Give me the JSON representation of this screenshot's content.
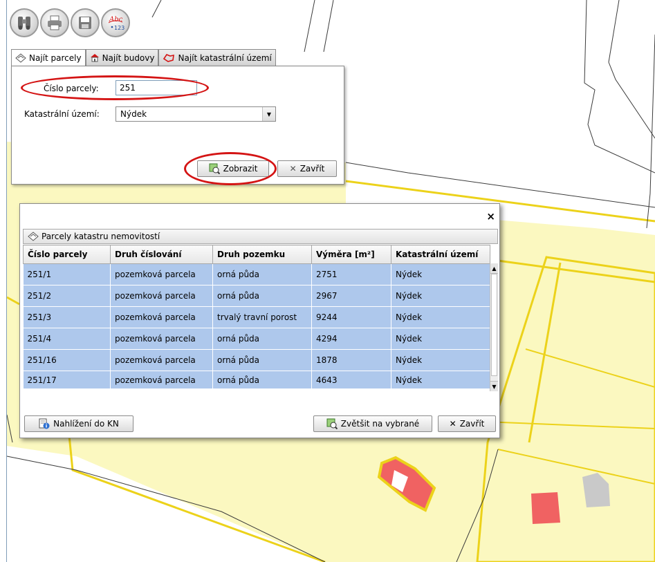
{
  "toolbar": {
    "buttons": [
      {
        "icon": "binoculars-icon"
      },
      {
        "icon": "printer-icon"
      },
      {
        "icon": "save-icon"
      },
      {
        "icon": "spellcheck-icon",
        "text_top": "Abc",
        "text_bottom": "123"
      }
    ]
  },
  "search": {
    "tabs": [
      {
        "label": "Najít parcely",
        "icon": "parcel-icon",
        "active": true
      },
      {
        "label": "Najít budovy",
        "icon": "house-icon",
        "active": false
      },
      {
        "label": "Najít katastrální území",
        "icon": "territory-outline-icon",
        "active": false
      }
    ],
    "parcel_label": "Číslo parcely:",
    "parcel_value": "251",
    "territory_label": "Katastrální území:",
    "territory_value": "Nýdek",
    "show_button": "Zobrazit",
    "close_button": "Zavřít"
  },
  "results": {
    "group_title": "Parcely katastru nemovitostí",
    "columns": [
      "Číslo parcely",
      "Druh číslování",
      "Druh pozemku",
      "Výměra [m²]",
      "Katastrální území"
    ],
    "rows": [
      [
        "251/1",
        "pozemková parcela",
        "orná půda",
        "2751",
        "Nýdek"
      ],
      [
        "251/2",
        "pozemková parcela",
        "orná půda",
        "2967",
        "Nýdek"
      ],
      [
        "251/3",
        "pozemková parcela",
        "trvalý travní porost",
        "9244",
        "Nýdek"
      ],
      [
        "251/4",
        "pozemková parcela",
        "orná půda",
        "4294",
        "Nýdek"
      ],
      [
        "251/16",
        "pozemková parcela",
        "orná půda",
        "1878",
        "Nýdek"
      ],
      [
        "251/17",
        "pozemková parcela",
        "orná půda",
        "4643",
        "Nýdek"
      ]
    ],
    "kn_button": "Nahlížení do KN",
    "zoom_button": "Zvětšit na vybrané",
    "close_button": "Zavřít"
  },
  "colors": {
    "parcel_fill": "#fbf8c0",
    "parcel_border": "#ecd21a",
    "selection": "#aec8ec",
    "highlight_ring": "#d41414",
    "building_red": "#f06262",
    "building_grey": "#c9c9c9"
  }
}
